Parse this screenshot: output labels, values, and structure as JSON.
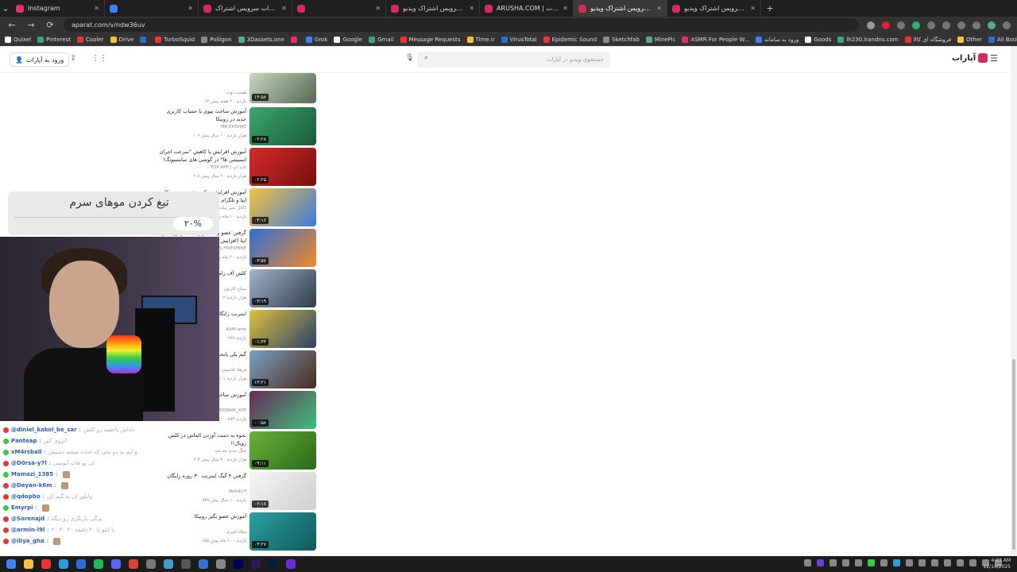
{
  "browser": {
    "tabs": [
      {
        "title": "Instagram",
        "color": "#e1306c"
      },
      {
        "title": "",
        "color": "#3b82f6"
      },
      {
        "title": "سوره کانال | آپارات سرویس اشتراک",
        "color": "#d72a5c"
      },
      {
        "title": "",
        "color": "#d72a5c"
      },
      {
        "title": "آپارات - سرویس اشتراک ویدیو",
        "color": "#d72a5c"
      },
      {
        "title": "ARUSHA.COM | آپارات",
        "color": "#d72a5c"
      },
      {
        "title": "آپارات - سرویس اشتراک ویدیو",
        "color": "#d72a5c"
      },
      {
        "title": "آپارات - سرویس اشتراک ویدیو",
        "color": "#d72a5c"
      }
    ],
    "url": "aparat.com/v/ndw36uv",
    "bookmarks": [
      "Quixel",
      "Pinterest",
      "Cooler",
      "Drive",
      "",
      "TurboSquid",
      "Polligon",
      "3Dassets.one",
      "",
      "Grok",
      "Google",
      "Gmail",
      "Message Requests",
      "Time.ir",
      "VirusTotal",
      "Epidemic Sound",
      "Sketchfab",
      "MinePic",
      "ASMR For People W...",
      "ورود به سامانه",
      "Goods",
      "lh230.irandns.com",
      "فروشگاه ای کالا",
      "Other",
      "All Bookmarks"
    ]
  },
  "site": {
    "brand": "آپارات",
    "login_label": "ورود به آپارات",
    "search_placeholder": "جستجوی ویدیو در آپارات"
  },
  "videos": [
    {
      "title": "",
      "channel": "هست دوت",
      "stats": "۶۴ بازدید · ۲ هفته پیش",
      "duration": "۱۴:۵۸",
      "colors": [
        "#c8d6c0",
        "#54694f"
      ]
    },
    {
      "title": "آموزش ساخت پیوی با حساب کاربری جدید در روبیکا",
      "channel": "MR.EHSHAT",
      "stats": "۱۰۷ هزار بازدید · ۱ سال پیش",
      "duration": "۰۲:۲۸",
      "colors": [
        "#3aa86b",
        "#1a5a3a"
      ]
    },
    {
      "title": "آموزش افزایش یا کاهش \"سرعت اجرای انیمیشن ها\" در گوشی های سامسونگ!",
      "channel": "TOP APP | تاپ اپ",
      "stats": "۲.۸ هزار بازدید · ۲ سال پیش",
      "duration": "۰۲:۲۵",
      "colors": [
        "#d32b2b",
        "#7a0f0f"
      ]
    },
    {
      "title": "آموزش افزایش سکه و عضو در روبیکا، ایتا و تلگرام بصورت نامحدود",
      "channel": "کانال سیر تیکت",
      "stats": "۴۸ بازدید · ۱ ماه پیش",
      "duration": "۰۴:۱۶",
      "colors": [
        "#f5c33a",
        "#3a7ae0"
      ]
    },
    {
      "title": "گرفتن عضو واقعی و رایگان در روبیکا و ایتا (افزایش واقعی) زیاد کردن عضو",
      "channel": "TES FIRESHINE",
      "stats": "۱۴ بازدید · ۲ ماه پیش",
      "duration": "۰۳:۵۷",
      "colors": [
        "#2a6fd6",
        "#f08a24"
      ]
    },
    {
      "title": "کلش آف زامبی UR",
      "channel": "سیاح کارتون",
      "stats": "۲ هزار بازدید",
      "duration": "۰۳:۱۹",
      "colors": [
        "#a0b4c8",
        "#2e3c4a"
      ]
    },
    {
      "title": "اینترنت رایگان",
      "channel": "AXM wire",
      "stats": "۹۹۷ بازدید",
      "duration": "۰۱:۳۳",
      "colors": [
        "#e0c23a",
        "#2a3f6a"
      ]
    },
    {
      "title": "گیم پلی پابجی خودت بساز!",
      "channel": "فرهاد قاسمی",
      "stats": "۱.۱ هزار بازدید",
      "duration": "۱۳:۲۱",
      "colors": [
        "#7aa0c4",
        "#4a2a1a"
      ]
    },
    {
      "title": "آموزش ساخت",
      "channel": "PEDRAM_XPP",
      "stats": "۸۷۳ بازدید",
      "duration": "۰۰:۵۸",
      "colors": [
        "#6a2a5a",
        "#3ac07a"
      ]
    },
    {
      "title": "نحوه به دست آوردن الماس در کلش رویال!!",
      "channel": "جنگ جدید جه شد",
      "stats": "۲.۳ هزار بازدید · ۳ سال پیش",
      "duration": "۰۹:۱۱",
      "colors": [
        "#6ab03a",
        "#2a6a1a"
      ]
    },
    {
      "title": "گرفتن ۴ گیگ اینترنت ۳۰ روزه رایگان",
      "channel": "Mehdi۱۳",
      "stats": "۸۳۸ بازدید · ۱ سال پیش",
      "duration": "۰۲:۱۸",
      "colors": [
        "#f5f5f5",
        "#cfcfcf"
      ]
    },
    {
      "title": "آموزش عضو بگیر روبیکا",
      "channel": "میلاد امیری",
      "stats": "۶۵۵ بازدید · ۱۰ ماه پیش",
      "duration": "۰۴:۲۷",
      "colors": [
        "#2aa0a0",
        "#0f5a5a"
      ]
    }
  ],
  "promo": {
    "text": "تیغ کردن موهای سرم",
    "percent": "۲۰%"
  },
  "chat": [
    {
      "user": "@diniel_kakol_be_sar",
      "msg": "داداش پاچسه رو کلش",
      "badge": "#e33"
    },
    {
      "user": "Panteap",
      "msg": "انزوی کور",
      "badge": "#3c4"
    },
    {
      "user": "xM4rsball",
      "msg": "و ایم یه دو بخی که اماده میشه دستش",
      "badge": "#3c4"
    },
    {
      "user": "@D0rsa-y7l",
      "msg": "لی یو هات آبوسی",
      "badge": "#e33"
    },
    {
      "user": "Mamazi_1385",
      "msg": "",
      "badge": "#3c4"
    },
    {
      "user": "@Deyan-k6m",
      "msg": "",
      "badge": "#e33"
    },
    {
      "user": "@qdopbo",
      "msg": "وایلور ان یه گیم کن",
      "badge": "#e33"
    },
    {
      "user": "Emyrpi",
      "msg": "",
      "badge": "#3c4"
    },
    {
      "user": "@Sorenajd",
      "msg": "برگی بازیگری رو دیگه",
      "badge": "#e33"
    },
    {
      "user": "@armin-l9l",
      "msg": "یا ایتو با ۲۰ دقیقه ۳۰ ۳۰ ۲۰",
      "badge": "#e33"
    },
    {
      "user": "@iliya_gha",
      "msg": "",
      "badge": "#e33"
    }
  ],
  "taskbar": {
    "time": "4:23 AM",
    "date": "12/14/2025"
  }
}
